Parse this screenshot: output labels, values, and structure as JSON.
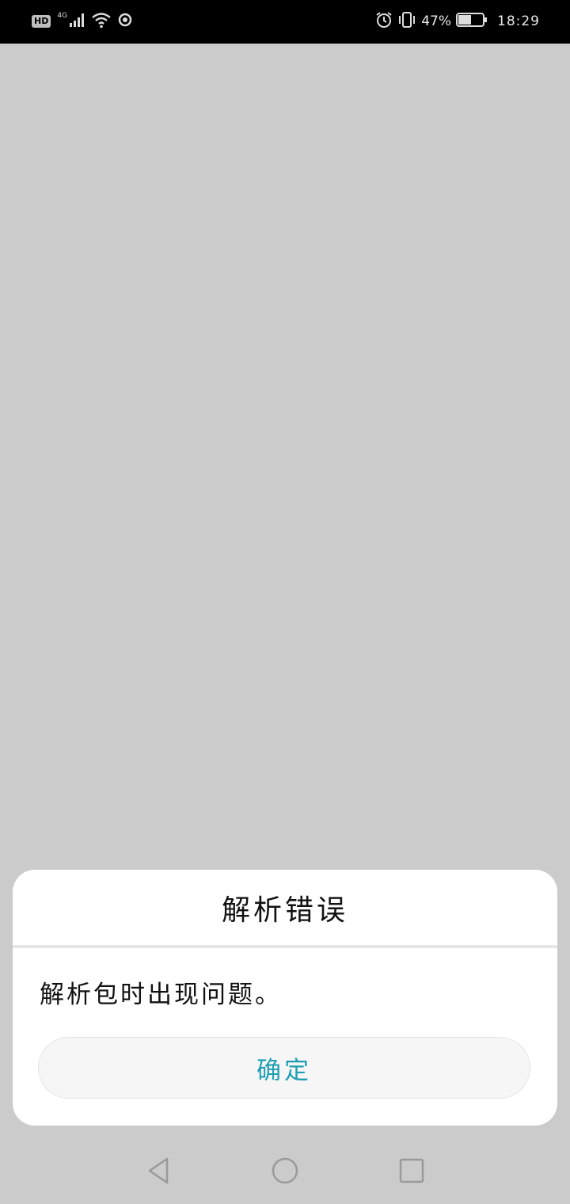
{
  "status_bar": {
    "hd_label": "HD",
    "network_label": "4G",
    "battery_percent": "47%",
    "time": "18:29",
    "icons": [
      "hd-icon",
      "signal-icon",
      "wifi-icon",
      "record-icon",
      "alarm-icon",
      "vibrate-icon",
      "battery-icon"
    ]
  },
  "dialog": {
    "title": "解析错误",
    "message": "解析包时出现问题。",
    "ok_label": "确定",
    "accent_color": "#1f9fb3"
  },
  "nav_bar": {
    "icons": [
      "back-icon",
      "home-icon",
      "recent-apps-icon"
    ]
  }
}
